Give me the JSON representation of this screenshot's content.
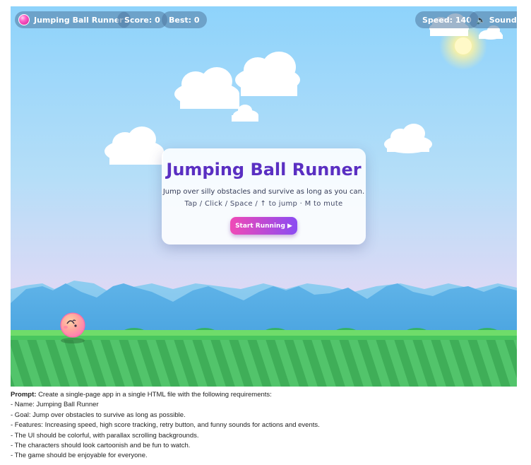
{
  "hud": {
    "title": "Jumping Ball Runner",
    "score_label": "Score:",
    "score_value": "0",
    "best_label": "Best:",
    "best_value": "0",
    "speed_label": "Speed:",
    "speed_value": "140",
    "sound_label": "Sound"
  },
  "start_card": {
    "title": "Jumping Ball Runner",
    "subtitle": "Jump over silly obstacles and survive as long as you can.",
    "controls": "Tap / Click / Space / ↑ to jump · M to mute",
    "start_button": "Start Running ▶"
  },
  "icons": {
    "ball": "ball-icon",
    "sound": "speaker-icon"
  },
  "colors": {
    "sky_top": "#8ed3fb",
    "sky_bottom": "#e6dcf4",
    "mountain": "#63b6ea",
    "grass": "#4cc163",
    "card_title": "#5a2fc2",
    "button_start": "#f04ab6",
    "button_end": "#8b4bf2",
    "player_ball": "#ff8fb6"
  },
  "prompt": {
    "label": "Prompt:",
    "intro": "Create a single-page app in a single HTML file with the following requirements:",
    "lines": [
      "- Name: Jumping Ball Runner",
      "- Goal: Jump over obstacles to survive as long as possible.",
      "- Features: Increasing speed, high score tracking, retry button, and funny sounds for actions and events.",
      "- The UI should be colorful, with parallax scrolling backgrounds.",
      "- The characters should look cartoonish and be fun to watch.",
      "- The game should be enjoyable for everyone."
    ]
  }
}
